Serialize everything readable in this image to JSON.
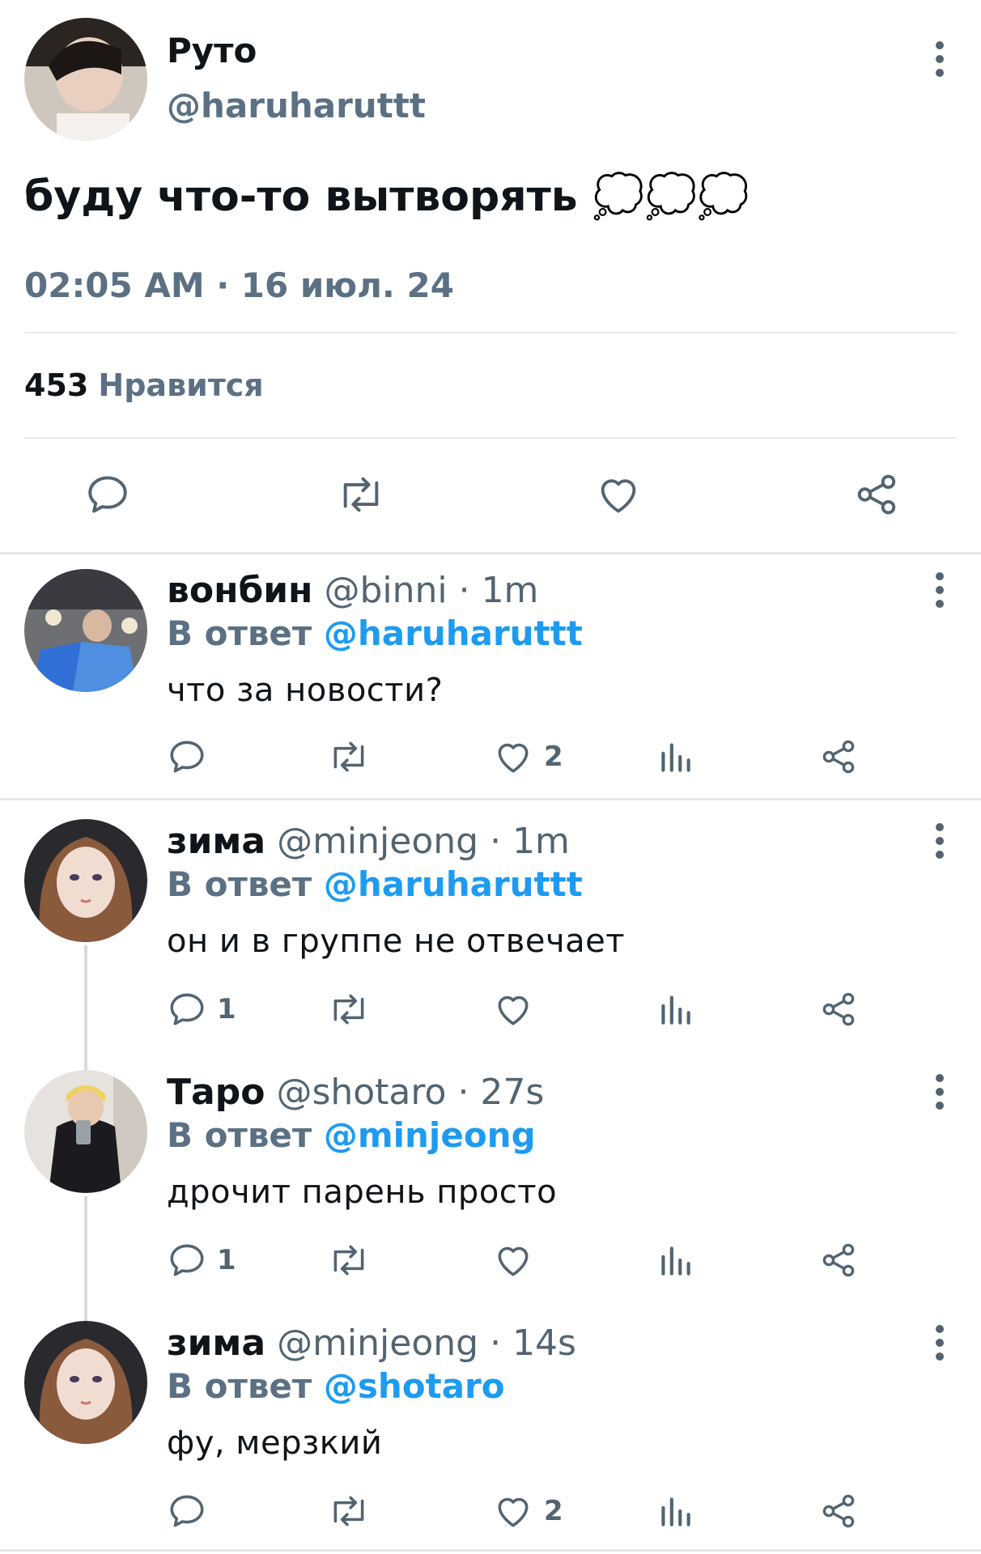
{
  "tweet": {
    "author_name": "Руто",
    "author_handle": "@haruharuttt",
    "text": "буду что-то вытворять 💭💭💭",
    "timestamp": "02:05 AM · 16 июл. 24",
    "likes_count": "453",
    "likes_label": "Нравится",
    "icons": [
      "reply-icon",
      "retweet-icon",
      "like-icon",
      "share-icon"
    ]
  },
  "replies": [
    {
      "name": "вонбин",
      "handle": "@binni",
      "time": "· 1m",
      "reply_label": "В ответ",
      "reply_to": "@haruharuttt",
      "text": "что за новости?",
      "reply_count": "",
      "like_count": "2"
    },
    {
      "name": "зима",
      "handle": "@minjeong",
      "time": "· 1m",
      "reply_label": "В ответ",
      "reply_to": "@haruharuttt",
      "text": "он и в группе не отвечает",
      "reply_count": "1",
      "like_count": ""
    },
    {
      "name": "Таро",
      "handle": "@shotaro",
      "time": "· 27s",
      "reply_label": "В ответ",
      "reply_to": "@minjeong",
      "text": "дрочит парень просто",
      "reply_count": "1",
      "like_count": ""
    },
    {
      "name": "зима",
      "handle": "@minjeong",
      "time": "· 14s",
      "reply_label": "В ответ",
      "reply_to": "@shotaro",
      "text": "фу, мерзкий",
      "reply_count": "",
      "like_count": "2"
    }
  ],
  "colors": {
    "link_blue": "#1d9bf0",
    "muted_gray": "#536471",
    "timestamp_slate": "#5b7083"
  }
}
